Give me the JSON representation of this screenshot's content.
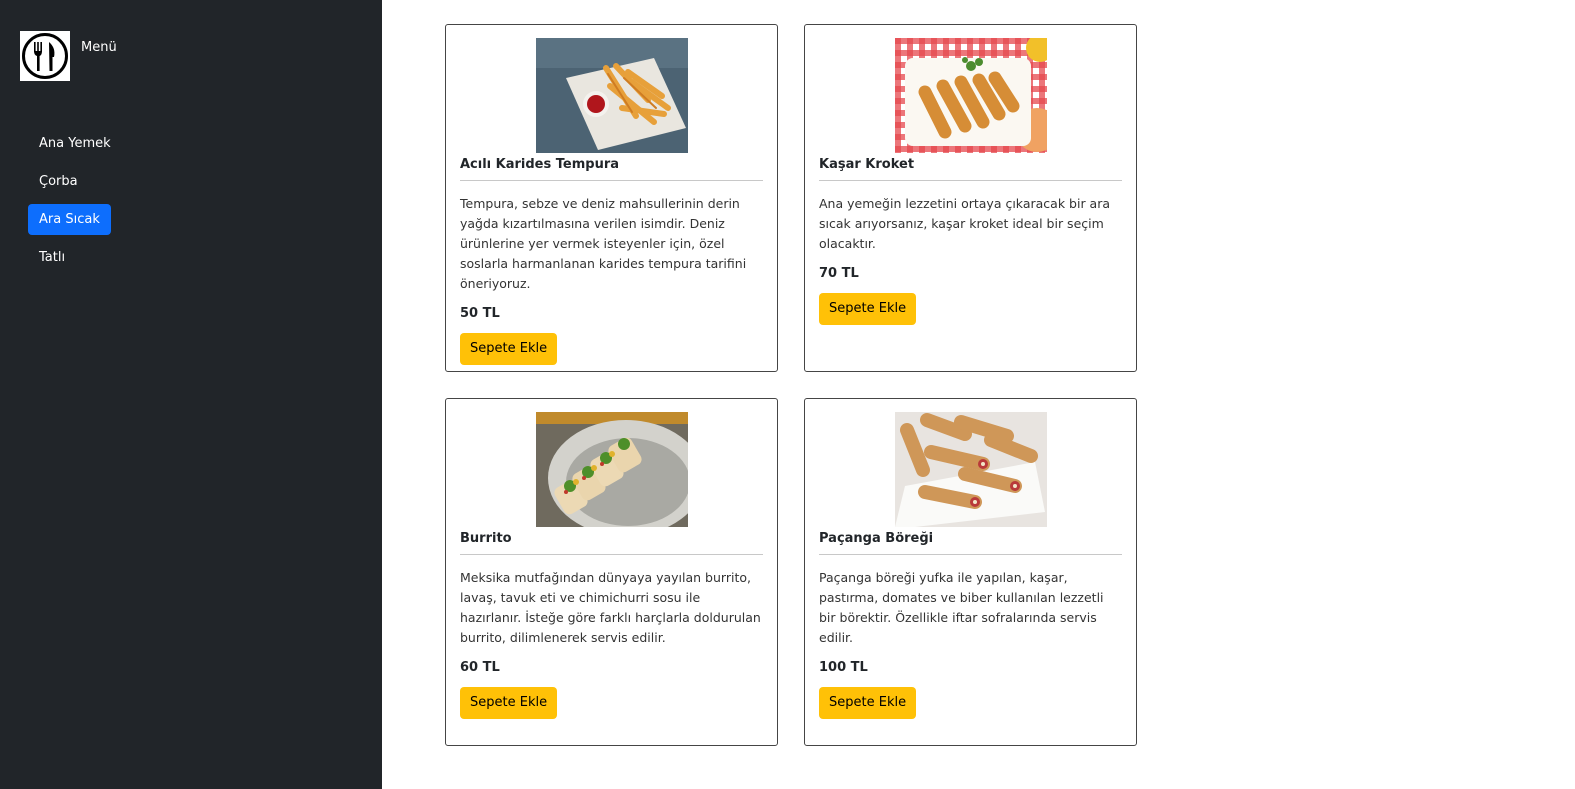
{
  "sidebar": {
    "brand_label": "Menü",
    "items": [
      {
        "label": "Ana Yemek",
        "active": false
      },
      {
        "label": "Çorba",
        "active": false
      },
      {
        "label": "Ara Sıcak",
        "active": true
      },
      {
        "label": "Tatlı",
        "active": false
      }
    ]
  },
  "products": [
    {
      "title": "Acılı Karides Tempura",
      "description": "Tempura, sebze ve deniz mahsullerinin derin yağda kızartılmasına verilen isimdir. Deniz ürünlerine yer vermek isteyenler için, özel soslarla harmanlanan karides tempura tarifini öneriyoruz.",
      "price": "50 TL",
      "button": "Sepete Ekle"
    },
    {
      "title": "Kaşar Kroket",
      "description": "Ana yemeğin lezzetini ortaya çıkaracak bir ara sıcak arıyorsanız, kaşar kroket ideal bir seçim olacaktır.",
      "price": "70 TL",
      "button": "Sepete Ekle"
    },
    {
      "title": "Burrito",
      "description": "Meksika mutfağından dünyaya yayılan burrito, lavaş, tavuk eti ve chimichurri sosu ile hazırlanır. İsteğe göre farklı harçlarla doldurulan burrito, dilimlenerek servis edilir.",
      "price": "60 TL",
      "button": "Sepete Ekle"
    },
    {
      "title": "Paçanga Böreği",
      "description": "Paçanga böreği yufka ile yapılan, kaşar, pastırma, domates ve biber kullanılan lezzetli bir börektir. Özellikle iftar sofralarında servis edilir.",
      "price": "100 TL",
      "button": "Sepete Ekle"
    }
  ]
}
